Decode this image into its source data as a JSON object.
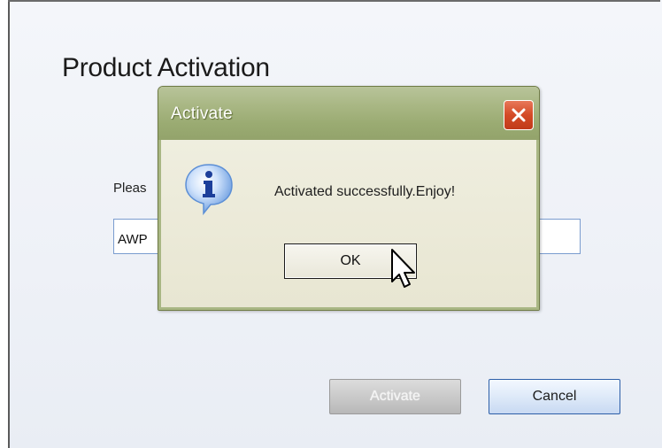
{
  "window": {
    "title": "Product Activation",
    "prompt": "Pleas",
    "key_value": "AWP",
    "activate_label": "Activate",
    "cancel_label": "Cancel"
  },
  "dialog": {
    "title": "Activate",
    "message": "Activated successfully.Enjoy!",
    "ok_label": "OK",
    "icon": "info-icon",
    "close_icon": "close-icon"
  },
  "colors": {
    "dialog_titlebar": "#a9b784",
    "close_button": "#d44a26",
    "input_border": "#7a9ccf",
    "cancel_border": "#2d5fa8"
  }
}
